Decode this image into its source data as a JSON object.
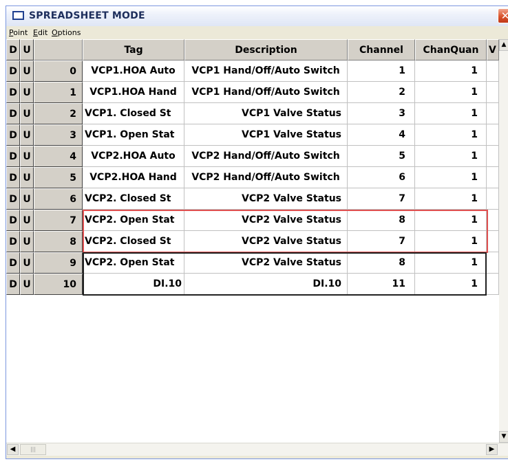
{
  "window": {
    "title": "SPREADSHEET MODE",
    "close_label": "✕"
  },
  "menu": {
    "point": {
      "underline": "P",
      "rest": "oint"
    },
    "edit": {
      "underline": "E",
      "rest": "dit"
    },
    "options": {
      "underline": "O",
      "rest": "ptions"
    }
  },
  "header": {
    "d": "D",
    "u": "U",
    "index": "",
    "tag": "Tag",
    "description": "Description",
    "channel": "Channel",
    "chanquan": "ChanQuan",
    "extra": "V"
  },
  "rows": [
    {
      "d": "D",
      "u": "U",
      "index": "0",
      "tag": "VCP1.HOA Auto",
      "description": "VCP1 Hand/Off/Auto Switch",
      "channel": "1",
      "chanquan": "1"
    },
    {
      "d": "D",
      "u": "U",
      "index": "1",
      "tag": "VCP1.HOA Hand",
      "description": "VCP1 Hand/Off/Auto Switch",
      "channel": "2",
      "chanquan": "1"
    },
    {
      "d": "D",
      "u": "U",
      "index": "2",
      "tag": "VCP1. Closed St",
      "description": "VCP1 Valve Status",
      "channel": "3",
      "chanquan": "1"
    },
    {
      "d": "D",
      "u": "U",
      "index": "3",
      "tag": "VCP1. Open Stat",
      "description": "VCP1 Valve Status",
      "channel": "4",
      "chanquan": "1"
    },
    {
      "d": "D",
      "u": "U",
      "index": "4",
      "tag": "VCP2.HOA Auto",
      "description": "VCP2 Hand/Off/Auto Switch",
      "channel": "5",
      "chanquan": "1"
    },
    {
      "d": "D",
      "u": "U",
      "index": "5",
      "tag": "VCP2.HOA Hand",
      "description": "VCP2 Hand/Off/Auto Switch",
      "channel": "6",
      "chanquan": "1"
    },
    {
      "d": "D",
      "u": "U",
      "index": "6",
      "tag": "VCP2. Closed St",
      "description": "VCP2 Valve Status",
      "channel": "7",
      "chanquan": "1"
    },
    {
      "d": "D",
      "u": "U",
      "index": "7",
      "tag": "VCP2. Open Stat",
      "description": "VCP2 Valve Status",
      "channel": "8",
      "chanquan": "1"
    },
    {
      "d": "D",
      "u": "U",
      "index": "8",
      "tag": "VCP2. Closed St",
      "description": "VCP2 Valve Status",
      "channel": "7",
      "chanquan": "1"
    },
    {
      "d": "D",
      "u": "U",
      "index": "9",
      "tag": "VCP2. Open Stat",
      "description": "VCP2 Valve Status",
      "channel": "8",
      "chanquan": "1"
    },
    {
      "d": "D",
      "u": "U",
      "index": "10",
      "tag": "DI.10",
      "description": "DI.10",
      "channel": "11",
      "chanquan": "1"
    }
  ],
  "scroll": {
    "up": "▲",
    "down": "▼",
    "left": "◀",
    "right": "▶",
    "grip": "|||"
  },
  "colors": {
    "highlight_red": "#e05050",
    "highlight_black": "#202020",
    "button_face": "#d4d0c8"
  }
}
